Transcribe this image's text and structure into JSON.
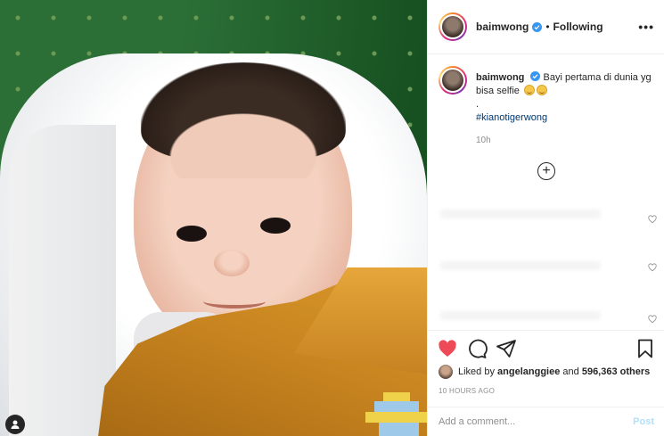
{
  "post": {
    "username": "baimwong",
    "follow_status": "Following",
    "separator": "•",
    "more_label": "•••"
  },
  "caption": {
    "username": "baimwong",
    "text": "Bayi pertama di dunia yg bisa selfie",
    "dot_line": ".",
    "hashtag": "#kianotigerwong",
    "age": "10h"
  },
  "likes": {
    "prefix": "Liked by",
    "user": "angelanggiee",
    "conjunction": "and",
    "count": "596,363 others"
  },
  "timestamp": "10 HOURS AGO",
  "comment_box": {
    "placeholder": "Add a comment...",
    "post_label": "Post"
  },
  "colors": {
    "like_red": "#ed4956",
    "verified_blue": "#3897f0",
    "hashtag_blue": "#00376b",
    "post_disabled": "#b2dffc"
  },
  "icons": [
    "heart-icon",
    "comment-icon",
    "share-icon",
    "bookmark-icon",
    "add-icon",
    "more-icon",
    "verified-icon"
  ]
}
